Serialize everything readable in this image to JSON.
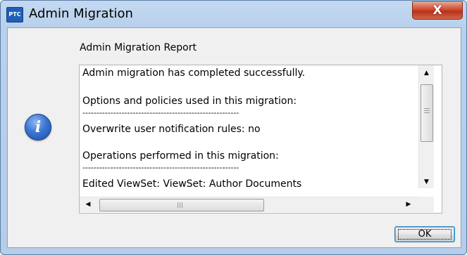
{
  "window": {
    "app_icon_text": "PTC",
    "title": "Admin Migration",
    "close_icon": "close-x-icon",
    "close_glyph": "X"
  },
  "dialog": {
    "icon": "info-icon",
    "icon_glyph": "i",
    "report_title": "Admin Migration Report",
    "report_lines": [
      "Admin migration has completed successfully.",
      "Options and policies used in this migration:",
      "--------------------------------------------------------",
      "Overwrite user notification rules: no",
      "Operations performed in this migration:",
      "--------------------------------------------------------",
      "Edited ViewSet: ViewSet: Author Documents"
    ],
    "ok_label": "OK"
  },
  "scrollbars": {
    "up_glyph": "▲",
    "down_glyph": "▼",
    "left_glyph": "◀",
    "right_glyph": "▶"
  }
}
